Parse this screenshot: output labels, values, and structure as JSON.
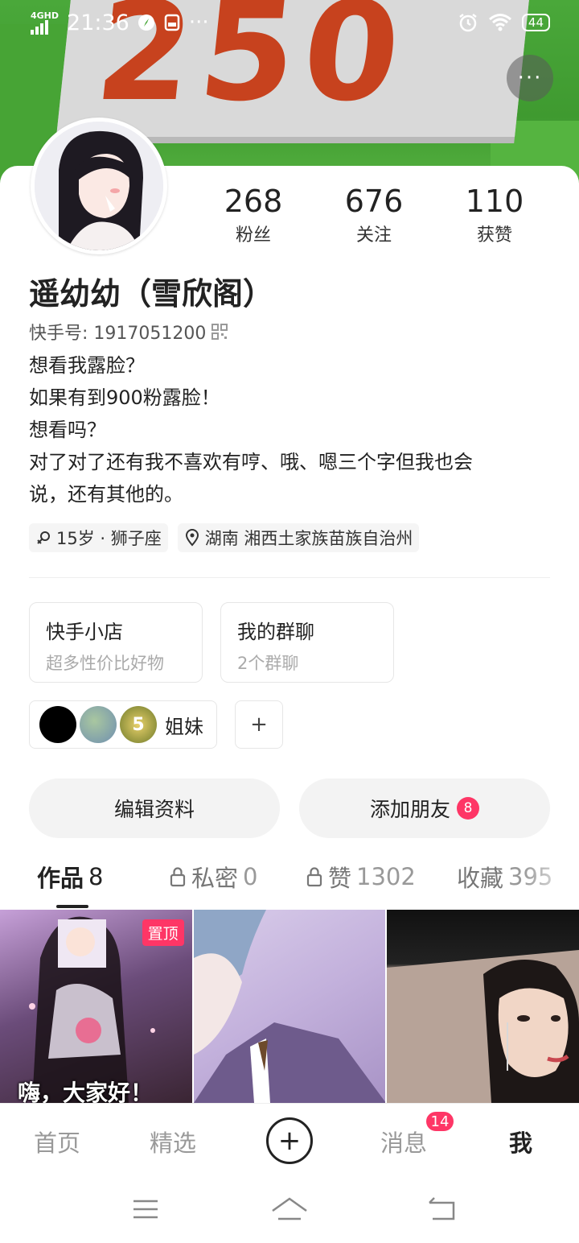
{
  "status_bar": {
    "network": "4GHD",
    "time": "21:36",
    "more": "···",
    "battery": "44"
  },
  "banner": {
    "sign_text": "250"
  },
  "header": {
    "more_button": "···"
  },
  "stats": [
    {
      "value": "268",
      "label": "粉丝"
    },
    {
      "value": "676",
      "label": "关注"
    },
    {
      "value": "110",
      "label": "获赞"
    }
  ],
  "profile": {
    "name": "遥幼幼（雪欣阁）",
    "kuaishou_id": "快手号: 1917051200",
    "bio": [
      "想看我露脸？",
      "如果有到900粉露脸！",
      "想看吗？",
      "对了对了还有我不喜欢有哼、哦、嗯三个字但我也会",
      "说，还有其他的。"
    ],
    "tags": {
      "age": "15岁 · 狮子座",
      "location": "湖南 湘西土家族苗族自治州"
    }
  },
  "features": [
    {
      "title": "快手小店",
      "subtitle": "超多性价比好物"
    },
    {
      "title": "我的群聊",
      "subtitle": "2个群聊"
    }
  ],
  "group": {
    "label": "姐妹",
    "avatar_number": "5",
    "add": "+"
  },
  "actions": {
    "edit": "编辑资料",
    "add_friend": "添加朋友",
    "add_friend_badge": "8"
  },
  "tabs": [
    {
      "label": "作品",
      "count": "8",
      "locked": false
    },
    {
      "label": "私密",
      "count": "0",
      "locked": true
    },
    {
      "label": "赞",
      "count": "1302",
      "locked": true
    },
    {
      "label": "收藏",
      "count": "395",
      "locked": false
    }
  ],
  "grid": {
    "pinned_label": "置顶",
    "caption": "嗨，大家好！"
  },
  "bottom_nav": {
    "home": "首页",
    "featured": "精选",
    "messages": "消息",
    "messages_badge": "14",
    "me": "我"
  },
  "colors": {
    "accent": "#fe3666",
    "banner_green": "#4aa83a",
    "sign_red": "#c7421e"
  }
}
